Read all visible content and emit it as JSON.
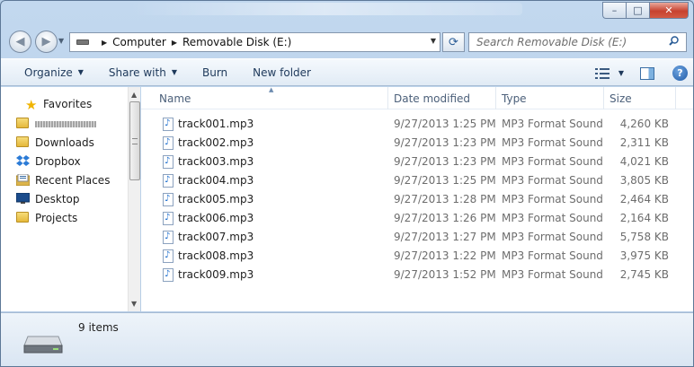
{
  "window": {
    "controls": {
      "minimize": "–",
      "maximize": "□",
      "close": "✕"
    }
  },
  "address_bar": {
    "crumbs": [
      "Computer",
      "Removable Disk (E:)"
    ],
    "search_placeholder": "Search Removable Disk (E:)"
  },
  "toolbar": {
    "organize": "Organize",
    "share_with": "Share with",
    "burn": "Burn",
    "new_folder": "New folder"
  },
  "nav_pane": {
    "favorites_label": "Favorites",
    "items": [
      {
        "label": "",
        "icon": "folder-icon",
        "blurred": true
      },
      {
        "label": "Downloads",
        "icon": "downloads-folder-icon"
      },
      {
        "label": "Dropbox",
        "icon": "dropbox-icon"
      },
      {
        "label": "Recent Places",
        "icon": "recent-places-icon"
      },
      {
        "label": "Desktop",
        "icon": "desktop-icon"
      },
      {
        "label": "Projects",
        "icon": "folder-icon"
      }
    ]
  },
  "columns": {
    "name": "Name",
    "date": "Date modified",
    "type": "Type",
    "size": "Size"
  },
  "files": [
    {
      "name": "track001.mp3",
      "date": "9/27/2013 1:25 PM",
      "type": "MP3 Format Sound",
      "size": "4,260 KB"
    },
    {
      "name": "track002.mp3",
      "date": "9/27/2013 1:23 PM",
      "type": "MP3 Format Sound",
      "size": "2,311 KB"
    },
    {
      "name": "track003.mp3",
      "date": "9/27/2013 1:23 PM",
      "type": "MP3 Format Sound",
      "size": "4,021 KB"
    },
    {
      "name": "track004.mp3",
      "date": "9/27/2013 1:25 PM",
      "type": "MP3 Format Sound",
      "size": "3,805 KB"
    },
    {
      "name": "track005.mp3",
      "date": "9/27/2013 1:28 PM",
      "type": "MP3 Format Sound",
      "size": "2,464 KB"
    },
    {
      "name": "track006.mp3",
      "date": "9/27/2013 1:26 PM",
      "type": "MP3 Format Sound",
      "size": "2,164 KB"
    },
    {
      "name": "track007.mp3",
      "date": "9/27/2013 1:27 PM",
      "type": "MP3 Format Sound",
      "size": "5,758 KB"
    },
    {
      "name": "track008.mp3",
      "date": "9/27/2013 1:22 PM",
      "type": "MP3 Format Sound",
      "size": "3,975 KB"
    },
    {
      "name": "track009.mp3",
      "date": "9/27/2013 1:52 PM",
      "type": "MP3 Format Sound",
      "size": "2,745 KB"
    }
  ],
  "status": {
    "item_count": "9 items"
  }
}
